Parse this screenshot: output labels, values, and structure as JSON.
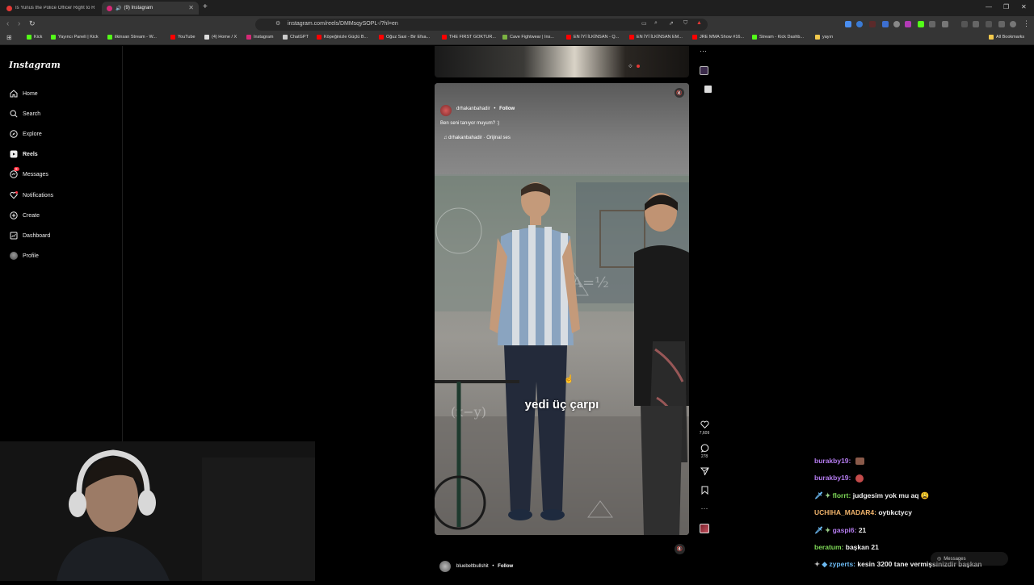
{
  "browser": {
    "tabs": [
      {
        "title": "Is Yunus the Police Officer Right to R",
        "active": false,
        "favicon_color": "#e53935"
      },
      {
        "title": "(9) Instagram",
        "active": true,
        "favicon_color": "#d62976"
      }
    ],
    "url": "instagram.com/reels/DMMsqySOPL-/?hl=en",
    "bookmarks": [
      {
        "label": "Kick",
        "icon_color": "#53fc18"
      },
      {
        "label": "Yayıncı Paneli | Kick",
        "icon_color": "#53fc18"
      },
      {
        "label": "ilkinsan Stream - W...",
        "icon_color": "#53fc18"
      },
      {
        "label": "YouTube",
        "icon_color": "#ff0000"
      },
      {
        "label": "(4) Home / X",
        "icon_color": "#dddddd"
      },
      {
        "label": "Instagram",
        "icon_color": "#d62976"
      },
      {
        "label": "ChatGPT",
        "icon_color": "#cccccc"
      },
      {
        "label": "Köpeğinizle Güçlü B...",
        "icon_color": "#ff0000"
      },
      {
        "label": "Oğuz Sasi - Bir Efsa...",
        "icon_color": "#ff0000"
      },
      {
        "label": "THE FIRST GOKTUR...",
        "icon_color": "#ff0000"
      },
      {
        "label": "Cave Fightwear | Ins...",
        "icon_color": "#7cb342"
      },
      {
        "label": "EN İYİ İLKİNSAN - Q...",
        "icon_color": "#ff0000"
      },
      {
        "label": "EN İYİ İLKİNSAN EM...",
        "icon_color": "#ff0000"
      },
      {
        "label": "JRE MMA Show #16...",
        "icon_color": "#ff0000"
      },
      {
        "label": "Stream - Kick Dashb...",
        "icon_color": "#53fc18"
      },
      {
        "label": "yayın",
        "icon_color": "#f2c94c"
      },
      {
        "label": "All Bookmarks",
        "icon_color": "#f2c94c"
      }
    ]
  },
  "instagram": {
    "logo": "Instagram",
    "nav": [
      {
        "label": "Home",
        "icon": "home-icon"
      },
      {
        "label": "Search",
        "icon": "search-icon"
      },
      {
        "label": "Explore",
        "icon": "compass-icon"
      },
      {
        "label": "Reels",
        "icon": "reels-icon"
      },
      {
        "label": "Messages",
        "icon": "messenger-icon",
        "badge": "9"
      },
      {
        "label": "Notifications",
        "icon": "heart-icon"
      },
      {
        "label": "Create",
        "icon": "plus-square-icon"
      },
      {
        "label": "Dashboard",
        "icon": "dashboard-icon"
      },
      {
        "label": "Profile",
        "icon": "avatar-icon"
      }
    ],
    "reel": {
      "username": "drhakanbahadir",
      "follow_label": "Follow",
      "caption": "Ben seni tanıyor muyum? :)",
      "audio": "drhakanbahadir · Orijinal ses",
      "subtitle": "yedi üç çarpı",
      "likes": "7,609",
      "comments": "278"
    },
    "next_reel": {
      "username": "bluebeltbullshit",
      "follow_label": "Follow"
    },
    "messages_pill": {
      "label": "Messages",
      "badge": "9"
    }
  },
  "stream_chat": [
    {
      "user": "burakby19:",
      "message": "",
      "user_color": "#b57cf0",
      "emote": true
    },
    {
      "user": "burakby19:",
      "message": "",
      "user_color": "#b57cf0",
      "emote": true
    },
    {
      "user": "florrt:",
      "message": "judgesim yok mu aq",
      "user_color": "#7ed957"
    },
    {
      "user": "UCHIHA_MADAR4:",
      "message": "oytıkctycy",
      "user_color": "#f0b36b"
    },
    {
      "user": "gaspi6:",
      "message": "21",
      "user_color": "#b57cf0"
    },
    {
      "user": "beratum:",
      "message": "başkan 21",
      "user_color": "#7ed957"
    },
    {
      "user": "zyperts:",
      "message": "kesin 3200 tane vermişsinizdir başkan",
      "user_color": "#6bb8f0"
    }
  ]
}
